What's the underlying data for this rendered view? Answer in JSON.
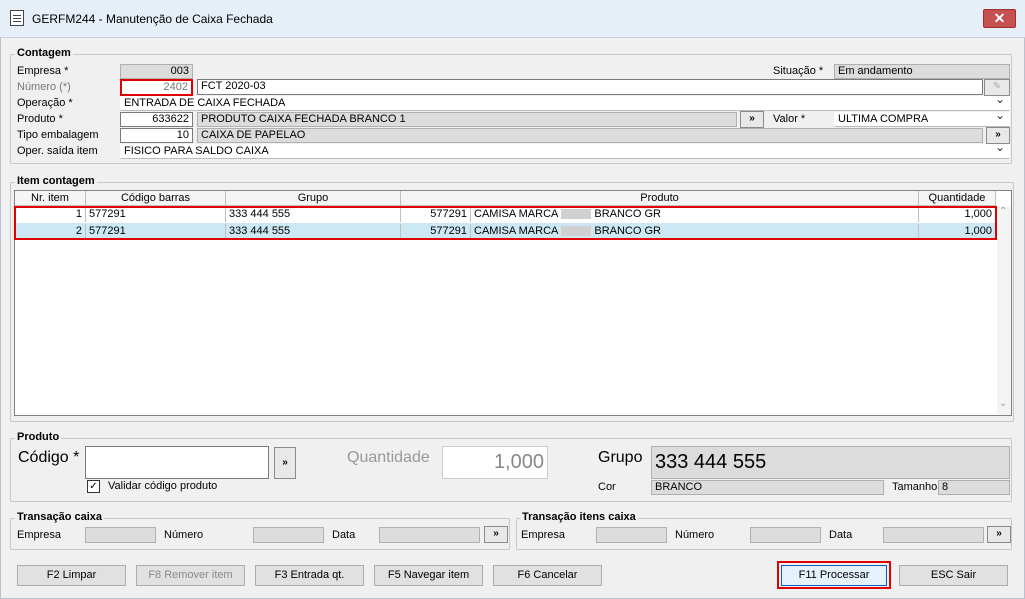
{
  "window": {
    "title": "GERFM244 - Manutenção de Caixa Fechada",
    "close": "✕"
  },
  "contagem": {
    "legend": "Contagem",
    "empresa_label": "Empresa *",
    "empresa_value": "003",
    "situacao_label": "Situação *",
    "situacao_value": "Em andamento",
    "numero_label": "Número (*)",
    "numero_value": "2402",
    "numero_desc": "FCT 2020-03",
    "operacao_label": "Operação *",
    "operacao_value": "ENTRADA DE CAIXA FECHADA",
    "produto_label": "Produto *",
    "produto_code": "633622",
    "produto_desc": "PRODUTO CAIXA FECHADA BRANCO 1",
    "valor_label": "Valor *",
    "valor_value": "ULTIMA COMPRA",
    "tipo_label": "Tipo embalagem",
    "tipo_code": "10",
    "tipo_desc": "CAIXA DE PAPELAO",
    "oper_label": "Oper. saída item",
    "oper_value": "FISICO PARA SALDO CAIXA",
    "arrow": "»"
  },
  "items": {
    "legend": "Item contagem",
    "columns": [
      "Nr. item",
      "Código barras",
      "Grupo",
      "Produto",
      "Quantidade"
    ],
    "rows": [
      {
        "nr": "1",
        "barras": "577291",
        "grupo": "333 444 555",
        "prod_code": "577291",
        "prod_a": "CAMISA MARCA",
        "prod_b": "BRANCO GR",
        "qtd": "1,000"
      },
      {
        "nr": "2",
        "barras": "577291",
        "grupo": "333 444 555",
        "prod_code": "577291",
        "prod_a": "CAMISA MARCA",
        "prod_b": "BRANCO GR",
        "qtd": "1,000"
      }
    ]
  },
  "produto": {
    "legend": "Produto",
    "codigo_label": "Código *",
    "codigo_value": "",
    "quantidade_label": "Quantidade",
    "quantidade_value": "1,000",
    "grupo_label": "Grupo",
    "grupo_value": "333 444 555",
    "cor_label": "Cor",
    "cor_value": "BRANCO",
    "tamanho_label": "Tamanho",
    "tamanho_value": "8",
    "validar_label": "Validar código produto",
    "validar_checked": "✓"
  },
  "transacao_caixa": {
    "legend": "Transação caixa",
    "empresa": "Empresa",
    "numero": "Número",
    "data": "Data"
  },
  "transacao_itens": {
    "legend": "Transação itens caixa",
    "empresa": "Empresa",
    "numero": "Número",
    "data": "Data"
  },
  "buttons": {
    "limpar": "F2 Limpar",
    "remover": "F8 Remover item",
    "entrada": "F3 Entrada qt.",
    "navegar": "F5 Navegar item",
    "cancelar": "F6 Cancelar",
    "processar": "F11 Processar",
    "sair": "ESC Sair"
  },
  "colors": {
    "highlight": "#cce8f4",
    "alert": "#e00000"
  }
}
